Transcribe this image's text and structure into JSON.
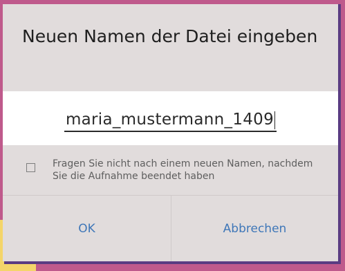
{
  "dialog": {
    "title": "Neuen Namen der Datei eingeben",
    "filename_value": "maria_mustermann_1409",
    "checkbox": {
      "checked": false,
      "label": "Fragen Sie nicht nach einem neuen Namen, nachdem Sie die Aufnahme beendet haben"
    },
    "buttons": {
      "ok_label": "OK",
      "cancel_label": "Abbrechen"
    }
  },
  "colors": {
    "background": "#bf5a8c",
    "dialog_bg": "#e1dcdc",
    "input_bg": "#ffffff",
    "button_text": "#3f77b8",
    "accent_yellow": "#f4d56a",
    "frame_shadow": "#5a3c82"
  }
}
